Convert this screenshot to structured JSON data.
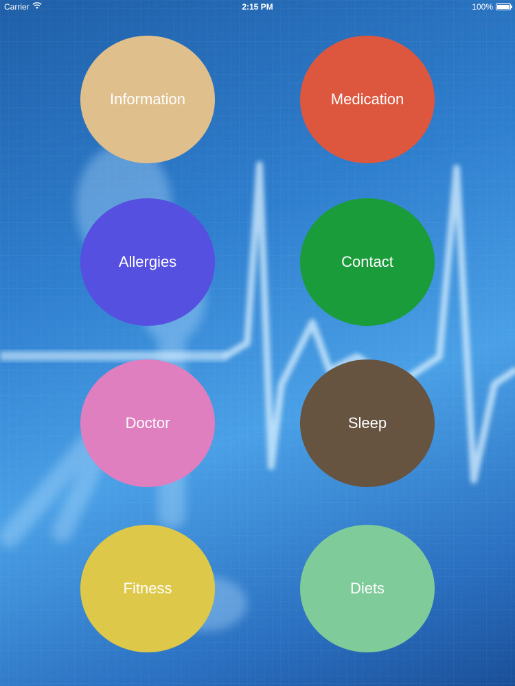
{
  "status_bar": {
    "carrier": "Carrier",
    "time": "2:15 PM",
    "battery_text": "100%",
    "battery_level": 1.0
  },
  "menu": {
    "information": {
      "label": "Information",
      "color": "#dfbf8b"
    },
    "medication": {
      "label": "Medication",
      "color": "#dd573f"
    },
    "allergies": {
      "label": "Allergies",
      "color": "#5650e1"
    },
    "contact": {
      "label": "Contact",
      "color": "#1b9c3b"
    },
    "doctor": {
      "label": "Doctor",
      "color": "#df7fbf"
    },
    "sleep": {
      "label": "Sleep",
      "color": "#665340"
    },
    "fitness": {
      "label": "Fitness",
      "color": "#ddc84a"
    },
    "diets": {
      "label": "Diets",
      "color": "#7fcb99"
    }
  },
  "background": {
    "description_icon": "heartbeat-skeleton-background"
  }
}
